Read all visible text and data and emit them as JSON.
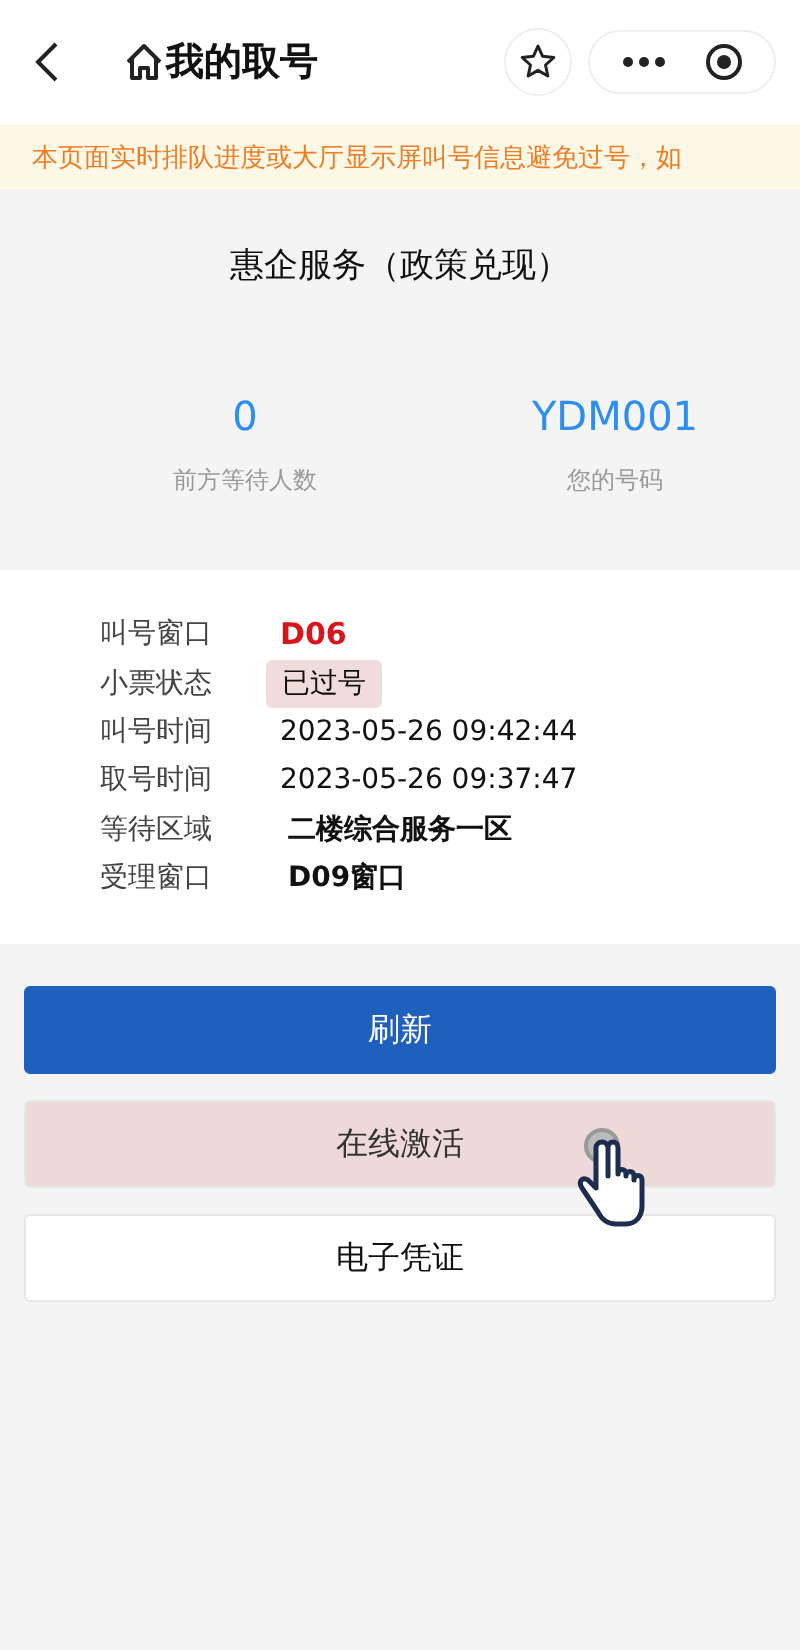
{
  "header": {
    "title": "我的取号"
  },
  "notice": "本页面实时排队进度或大厅显示屏叫号信息避免过号，如",
  "service": {
    "title": "惠企服务（政策兑现）"
  },
  "stats": [
    {
      "value": "0",
      "label": "前方等待人数"
    },
    {
      "value": "YDM001",
      "label": "您的号码"
    }
  ],
  "details": [
    {
      "label": "叫号窗口",
      "value": "D06",
      "kind": "alert"
    },
    {
      "label": "小票状态",
      "value": "已过号",
      "kind": "badge"
    },
    {
      "label": "叫号时间",
      "value": "2023-05-26 09:42:44",
      "kind": "plain"
    },
    {
      "label": "取号时间",
      "value": "2023-05-26 09:37:47",
      "kind": "plain"
    },
    {
      "label": "等待区域",
      "value": "二楼综合服务一区",
      "kind": "bold"
    },
    {
      "label": "受理窗口",
      "value": "D09窗口",
      "kind": "bold"
    }
  ],
  "buttons": [
    {
      "label": "刷新",
      "kind": "primary",
      "pointer": false
    },
    {
      "label": "在线激活",
      "kind": "warning",
      "pointer": true
    },
    {
      "label": "电子凭证",
      "kind": "plain",
      "pointer": false
    }
  ]
}
